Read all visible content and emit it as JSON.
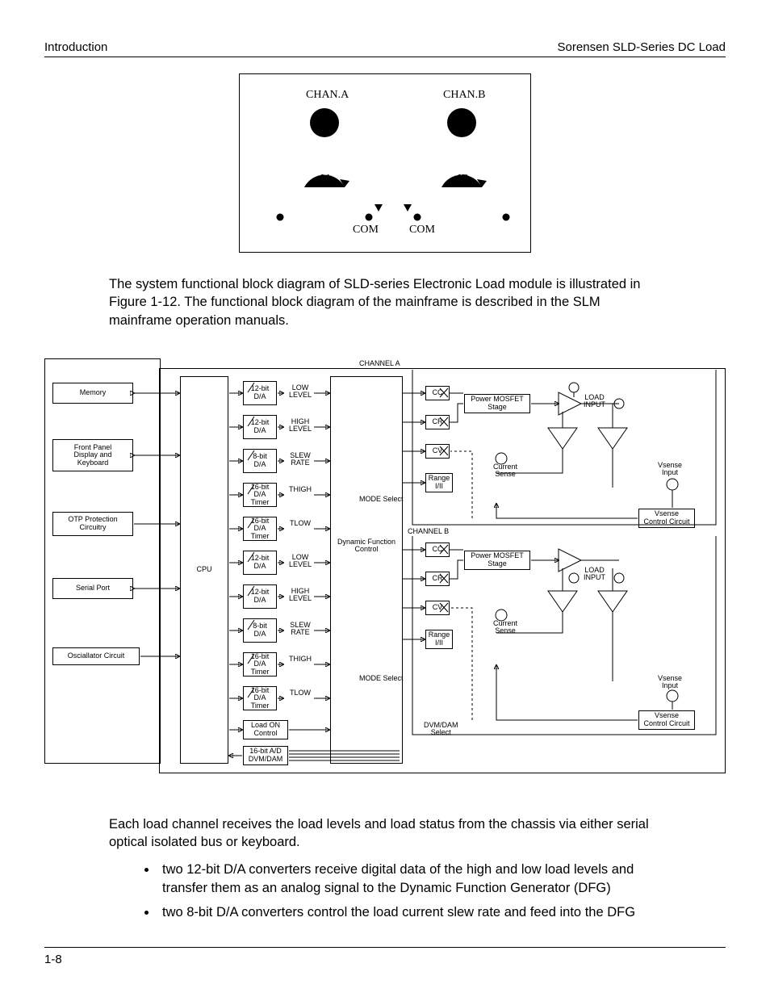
{
  "header": {
    "left": "Introduction",
    "right": "Sorensen SLD-Series DC Load"
  },
  "footer": {
    "page": "1-8"
  },
  "fig1": {
    "chan_a": "CHAN.A",
    "chan_b": "CHAN.B",
    "ia": "IA",
    "ib": "IB",
    "com_l": "COM",
    "com_r": "COM"
  },
  "para1": "The system functional block diagram of SLD-series Electronic Load module is illustrated in Figure 1-12. The functional block diagram of the mainframe is described in the SLM mainframe operation manuals.",
  "fig2": {
    "left_boxes": {
      "memory": "Memory",
      "front_panel": "Front Panel\nDisplay and\nKeyboard",
      "otp": "OTP Protection\nCircuitry",
      "serial": "Serial Port",
      "osc": "Osciallator Circuit"
    },
    "cpu": "CPU",
    "da_rows": [
      {
        "box": "12-bit\nD/A",
        "label": "LOW\nLEVEL"
      },
      {
        "box": "12-bit\nD/A",
        "label": "HIGH\nLEVEL"
      },
      {
        "box": "8-bit\nD/A",
        "label": "SLEW\nRATE"
      },
      {
        "box": "16-bit\nD/A\nTimer",
        "label": "THIGH"
      },
      {
        "box": "16-bit\nD/A\nTimer",
        "label": "TLOW"
      },
      {
        "box": "12-bit\nD/A",
        "label": "LOW\nLEVEL"
      },
      {
        "box": "12-bit\nD/A",
        "label": "HIGH\nLEVEL"
      },
      {
        "box": "8-bit\nD/A",
        "label": "SLEW\nRATE"
      },
      {
        "box": "16-bit\nD/A\nTimer",
        "label": "THIGH"
      },
      {
        "box": "16-bit\nD/A\nTimer",
        "label": "TLOW"
      }
    ],
    "load_on": "Load ON\nControl",
    "ad": "16-bit A/D\nDVM/DAM",
    "dfc": "Dynamic Function\nControl",
    "mode_sel": "MODE Select",
    "dvm_sel": "DVM/DAM\nSelect",
    "channel_a": "CHANNEL A",
    "channel_b": "CHANNEL B",
    "mode_boxes": {
      "cc": "CC",
      "cr": "CR",
      "cv": "CV",
      "range": "Range\nI/II"
    },
    "mosfet": "Power MOSFET\nStage",
    "current_sense": "Current\nSense",
    "load_input": "LOAD\nINPUT",
    "vsense_input": "Vsense\nInput",
    "vsense_ctrl": "Vsense\nControl Circuit"
  },
  "para2": "Each load channel receives the load levels and load status from the chassis via either serial optical isolated bus or keyboard.",
  "bullets": [
    "two 12-bit D/A converters receive digital data of the high and low load levels and transfer them as an analog signal to the Dynamic Function Generator (DFG)",
    "two 8-bit D/A converters control the load current slew rate and feed into the DFG"
  ]
}
